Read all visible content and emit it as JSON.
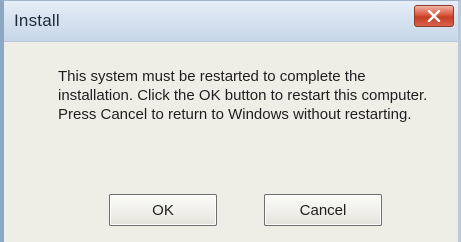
{
  "window": {
    "title": "Install",
    "close_icon": "close-icon"
  },
  "message": {
    "text": "This system must be restarted to complete the installation. Click the OK button to restart this computer. Press Cancel to return to Windows without restarting."
  },
  "buttons": {
    "ok_label": "OK",
    "cancel_label": "Cancel"
  },
  "colors": {
    "dialog_background": "#efeee6",
    "close_button": "#d9573f"
  }
}
